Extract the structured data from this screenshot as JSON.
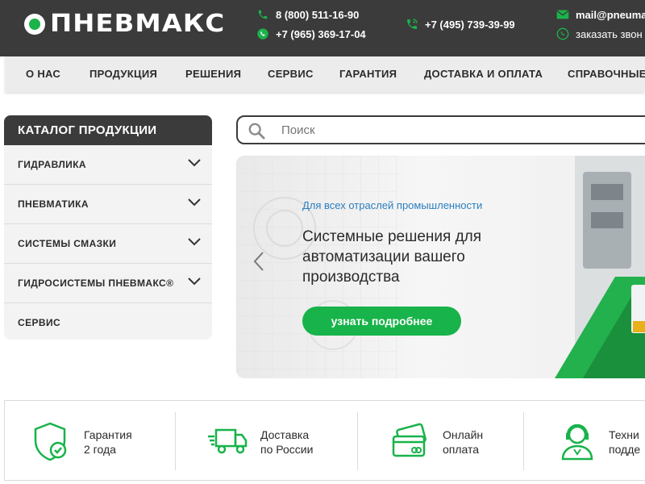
{
  "header": {
    "logo_text": "ПНЕВМАКС",
    "phone1": "8 (800) 511-16-90",
    "phone2": "+7 (965) 369-17-04",
    "phone3": "+7 (495) 739-39-99",
    "email": "mail@pneuma",
    "callback": "заказать звон"
  },
  "nav": {
    "items": [
      "О НАС",
      "ПРОДУКЦИЯ",
      "РЕШЕНИЯ",
      "СЕРВИС",
      "ГАРАНТИЯ",
      "ДОСТАВКА И ОПЛАТА",
      "СПРАВОЧНЫЕ"
    ]
  },
  "catalog": {
    "title": "КАТАЛОГ ПРОДУКЦИИ",
    "items": [
      "ГИДРАВЛИКА",
      "ПНЕВМАТИКА",
      "СИСТЕМЫ СМАЗКИ",
      "ГИДРОСИСТЕМЫ ПНЕВМАКС®",
      "СЕРВИС"
    ]
  },
  "search": {
    "placeholder": "Поиск"
  },
  "banner": {
    "tagline": "Для всех отраслей промышленности",
    "headline": "Системные решения для автоматизации вашего производства",
    "cta": "узнать подробнее"
  },
  "features": [
    {
      "line1": "Гарантия",
      "line2": "2 года",
      "icon": "shield-check-icon"
    },
    {
      "line1": "Доставка",
      "line2": "по России",
      "icon": "truck-icon"
    },
    {
      "line1": "Онлайн",
      "line2": "оплата",
      "icon": "credit-card-icon"
    },
    {
      "line1": "Техни",
      "line2": "подде",
      "icon": "support-agent-icon"
    }
  ],
  "colors": {
    "accent": "#18b34a",
    "dark": "#3b3b3b",
    "link": "#2a7fc0"
  }
}
